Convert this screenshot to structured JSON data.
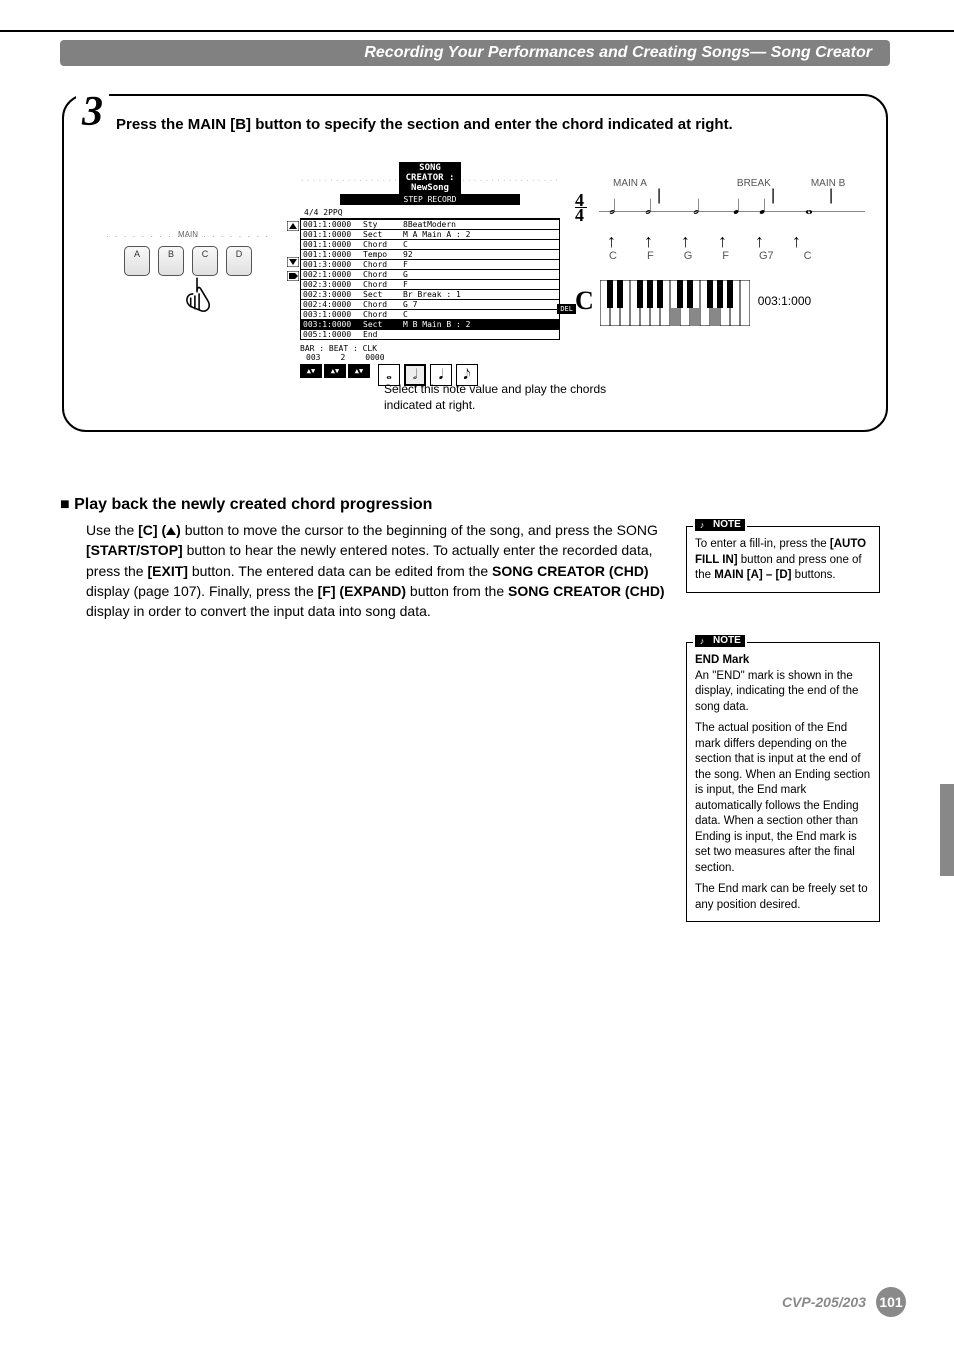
{
  "header": {
    "title": "Recording Your Performances and Creating Songs— Song Creator"
  },
  "step": {
    "number": "3",
    "instruction": "Press the MAIN [B] button to specify the section and enter the chord indicated at right."
  },
  "panel": {
    "section_label": "MAIN",
    "buttons": [
      "A",
      "B",
      "C",
      "D"
    ]
  },
  "lcd": {
    "title": "SONG CREATOR : NewSong",
    "tab": "STEP RECORD",
    "meta": "4/4    2PPQ",
    "rows": [
      {
        "pos": "001:1:0000",
        "type": "Sty",
        "val": "8BeatModern"
      },
      {
        "pos": "001:1:0000",
        "type": "Sect",
        "val": "M    A    Main A  : 2"
      },
      {
        "pos": "001:1:0000",
        "type": "Chord",
        "val": "C"
      },
      {
        "pos": "001:1:0000",
        "type": "Tempo",
        "val": "         92"
      },
      {
        "pos": "001:3:0000",
        "type": "Chord",
        "val": "F"
      },
      {
        "pos": "002:1:0000",
        "type": "Chord",
        "val": "G"
      },
      {
        "pos": "002:3:0000",
        "type": "Chord",
        "val": "F"
      },
      {
        "pos": "002:3:0000",
        "type": "Sect",
        "val": "       Br   Break  : 1"
      },
      {
        "pos": "002:4:0000",
        "type": "Chord",
        "val": "G      7"
      },
      {
        "pos": "003:1:0000",
        "type": "Chord",
        "val": "C"
      },
      {
        "pos": "003:1:0000",
        "type": "Sect",
        "val": "M    B    Main B  : 2",
        "inv": true
      },
      {
        "pos": "005:1:0000",
        "type": "End",
        "val": ""
      }
    ],
    "bbc_label": "BAR : BEAT : CLK",
    "bbc_vals": [
      "003",
      "2",
      "0000"
    ],
    "del": "DEL",
    "caption": "Select this note value and play the chords indicated at right."
  },
  "music": {
    "sections": [
      "MAIN A",
      "BREAK",
      "MAIN B"
    ],
    "timesig_top": "4",
    "timesig_bot": "4",
    "arrows": [
      "↑",
      "↑",
      "↑",
      "↑",
      "↑",
      "↑"
    ],
    "chords": [
      "C",
      "F",
      "G",
      "F",
      "G7",
      "C"
    ],
    "big_chord": "C",
    "kb_position": "003:1:000"
  },
  "subheading": "Play back the newly created chord progression",
  "paragraph": {
    "t1": "Use the ",
    "btn_c": "[C] (",
    "btn_c_close": ")",
    "t2": " button to move the cursor to the beginning of the song, and press the SONG ",
    "startstop": "[START/STOP]",
    "t3": " button to hear the newly entered notes. To actually enter the recorded data, press the ",
    "exit": "[EXIT]",
    "t4": " button. The entered data can be edited from the ",
    "creator_chd": "SONG CREATOR (CHD)",
    "t5": " display (page 107). Finally, press the ",
    "expand": "[F] (EXPAND)",
    "t6": " button from the ",
    "creator_chd2": "SONG CREATOR (CHD)",
    "t7": " display in order to convert the input data into song data."
  },
  "note1": {
    "tag": "NOTE",
    "t1": "To enter a fill-in, press the ",
    "b1": "[AUTO FILL IN]",
    "t2": " button and press one of the ",
    "b2": "MAIN [A] – [D]",
    "t3": " buttons."
  },
  "note2": {
    "tag": "NOTE",
    "title": "END Mark",
    "p1": "An \"END\" mark is shown in the display, indicating the end of the song data.",
    "p2": "The actual position of the End mark differs depending on the section that is input at the end of the song. When an Ending section is input, the End mark automatically follows the Ending data. When a section other than Ending is input, the End mark is set two measures after the final section.",
    "p3": "The End mark can be freely set to any position desired."
  },
  "footer": {
    "model": "CVP-205/203",
    "page": "101"
  }
}
